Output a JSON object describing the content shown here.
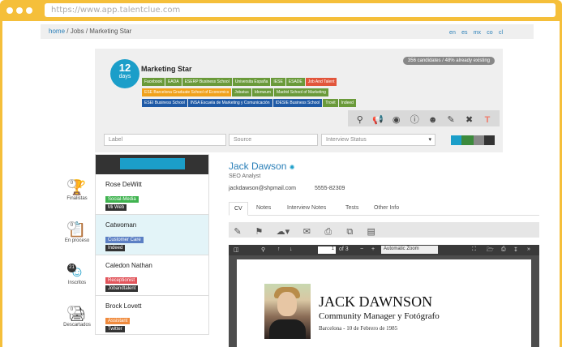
{
  "browser": {
    "url": "https://www.app.talentclue.com"
  },
  "breadcrumb": {
    "home": "home",
    "sep": " / ",
    "jobs": "Jobs",
    "current": "Marketing Star"
  },
  "languages": [
    "en",
    "es",
    "mx",
    "co",
    "cl"
  ],
  "job": {
    "days": "12",
    "days_label": "days",
    "title": "Marketing Star",
    "candidates_pill": "356 candidates / 48% already existing",
    "tag_rows": [
      [
        {
          "label": "Facebook",
          "color": "#6a9a3a"
        },
        {
          "label": "EADA",
          "color": "#6a9a3a"
        },
        {
          "label": "ESERP Business School",
          "color": "#6a9a3a"
        },
        {
          "label": "Universita España",
          "color": "#6a9a3a"
        },
        {
          "label": "IESE",
          "color": "#6a9a3a"
        },
        {
          "label": "ESADE",
          "color": "#6a9a3a"
        },
        {
          "label": "Job And Talent",
          "color": "#e2553b"
        }
      ],
      [
        {
          "label": "ESE Barcelona Graduate School of Economics",
          "color": "#f0a21c"
        },
        {
          "label": "Jobatus",
          "color": "#6a9a3a"
        },
        {
          "label": "Idonwum",
          "color": "#6a9a3a"
        },
        {
          "label": "Madrid School of Marketing",
          "color": "#6a9a3a"
        }
      ],
      [
        {
          "label": "ESEI Business School",
          "color": "#1f5aa6"
        },
        {
          "label": "INSA Escuela de Marketing y Comunicación",
          "color": "#1f5aa6"
        },
        {
          "label": "IDESIE Business School",
          "color": "#1f5aa6"
        },
        {
          "label": "Trovit",
          "color": "#6a9a3a"
        },
        {
          "label": "Indeed",
          "color": "#6a9a3a"
        }
      ]
    ]
  },
  "filters": {
    "label_placeholder": "Label",
    "source_placeholder": "Source",
    "status_placeholder": "Interview Status",
    "status_colors": [
      "#1b9ec9",
      "#3c8a3c",
      "#888888",
      "#333333"
    ]
  },
  "pipeline": [
    {
      "count": "0",
      "label": "Finalistas",
      "icon": "trophy-icon"
    },
    {
      "count": "0",
      "label": "En proceso",
      "icon": "clipboard-icon"
    },
    {
      "count": "21",
      "label": "Inscritos",
      "icon": "smiley-icon"
    },
    {
      "count": "0",
      "label": "Descartados",
      "icon": "shredder-icon"
    }
  ],
  "candidates": [
    {
      "name": "Rose DeWitt",
      "tags": [
        {
          "label": "Social-Media",
          "color": "#3fb34f"
        },
        {
          "label": "Mi Web",
          "color": "#333333"
        }
      ]
    },
    {
      "name": "Catwoman",
      "tags": [
        {
          "label": "Customer Care",
          "color": "#5b7fc4"
        },
        {
          "label": "Indeed",
          "color": "#333333"
        }
      ]
    },
    {
      "name": "Caledon Nathan",
      "tags": [
        {
          "label": "Receptionist",
          "color": "#e2555b"
        },
        {
          "label": "Jobandtalent",
          "color": "#333333"
        }
      ]
    },
    {
      "name": "Brock Lovett",
      "tags": [
        {
          "label": "Assistant",
          "color": "#f08a3c"
        },
        {
          "label": "Twitter",
          "color": "#333333"
        }
      ]
    }
  ],
  "detail": {
    "name": "Jack Dawson",
    "position": "SEO Analyst",
    "email": "jackdawson@shpmail.com",
    "phone": "5555-82309",
    "tabs": [
      "CV",
      "Notes",
      "Interview Notes",
      "Tests",
      "Other Info"
    ]
  },
  "pdf": {
    "page_num": "1",
    "page_total": "of 3",
    "zoom": "Automatic Zoom",
    "cv_name": "JACK DAWNSON",
    "cv_role": "Community Manager y Fotógrafo",
    "cv_place": "Barcelona - 10 de Febrero de 1985"
  }
}
